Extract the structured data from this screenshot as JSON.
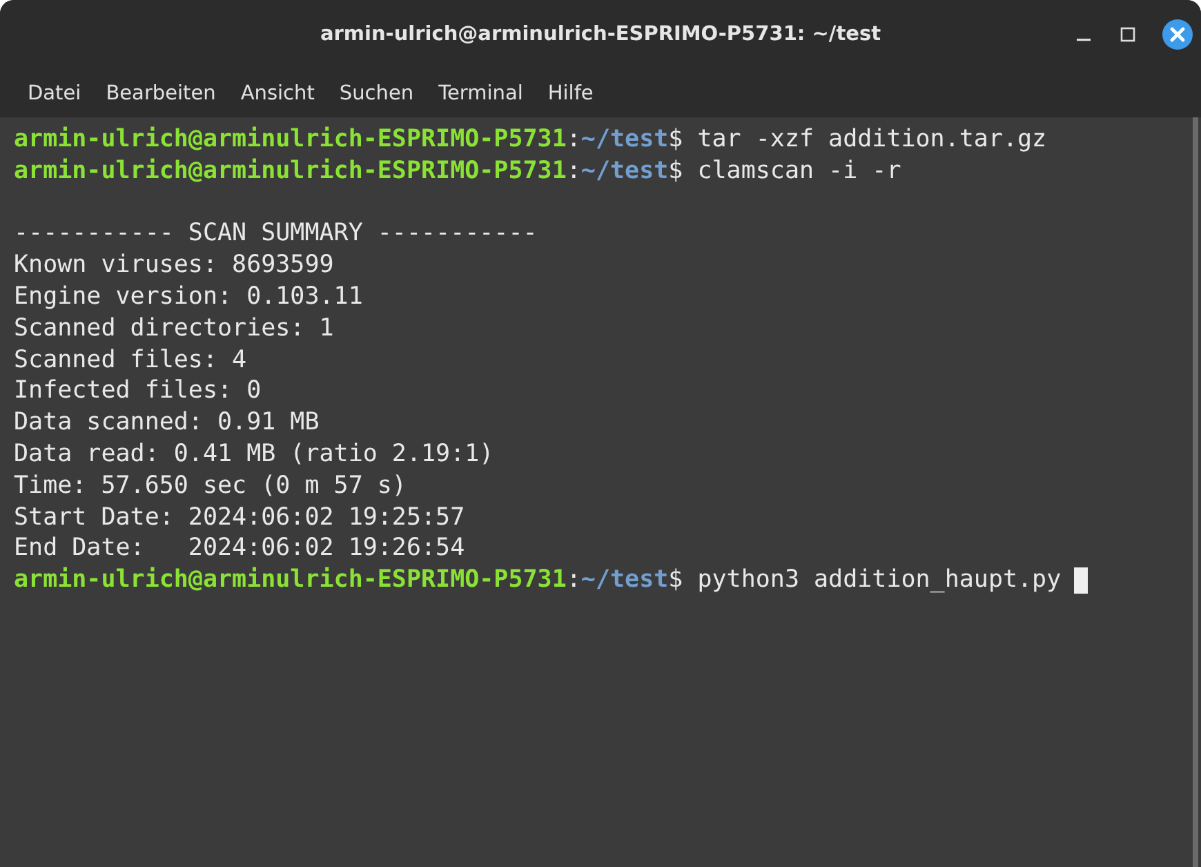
{
  "window": {
    "title": "armin-ulrich@arminulrich-ESPRIMO-P5731: ~/test"
  },
  "menu": [
    "Datei",
    "Bearbeiten",
    "Ansicht",
    "Suchen",
    "Terminal",
    "Hilfe"
  ],
  "terminal": {
    "lines": [
      {
        "kind": "prompt",
        "user": "armin-ulrich@arminulrich-ESPRIMO-P5731",
        "separator": ":",
        "path": "~/test",
        "symbol": "$",
        "command": "tar -xzf addition.tar.gz",
        "cursor": false
      },
      {
        "kind": "prompt",
        "user": "armin-ulrich@arminulrich-ESPRIMO-P5731",
        "separator": ":",
        "path": "~/test",
        "symbol": "$",
        "command": "clamscan -i -r",
        "cursor": false
      },
      {
        "kind": "blank"
      },
      {
        "kind": "output",
        "text": "----------- SCAN SUMMARY -----------"
      },
      {
        "kind": "output",
        "text": "Known viruses: 8693599"
      },
      {
        "kind": "output",
        "text": "Engine version: 0.103.11"
      },
      {
        "kind": "output",
        "text": "Scanned directories: 1"
      },
      {
        "kind": "output",
        "text": "Scanned files: 4"
      },
      {
        "kind": "output",
        "text": "Infected files: 0"
      },
      {
        "kind": "output",
        "text": "Data scanned: 0.91 MB"
      },
      {
        "kind": "output",
        "text": "Data read: 0.41 MB (ratio 2.19:1)"
      },
      {
        "kind": "output",
        "text": "Time: 57.650 sec (0 m 57 s)"
      },
      {
        "kind": "output",
        "text": "Start Date: 2024:06:02 19:25:57"
      },
      {
        "kind": "output",
        "text": "End Date:   2024:06:02 19:26:54"
      },
      {
        "kind": "prompt",
        "user": "armin-ulrich@arminulrich-ESPRIMO-P5731",
        "separator": ":",
        "path": "~/test",
        "symbol": "$",
        "command": "python3 addition_haupt.py",
        "cursor": true
      }
    ]
  }
}
